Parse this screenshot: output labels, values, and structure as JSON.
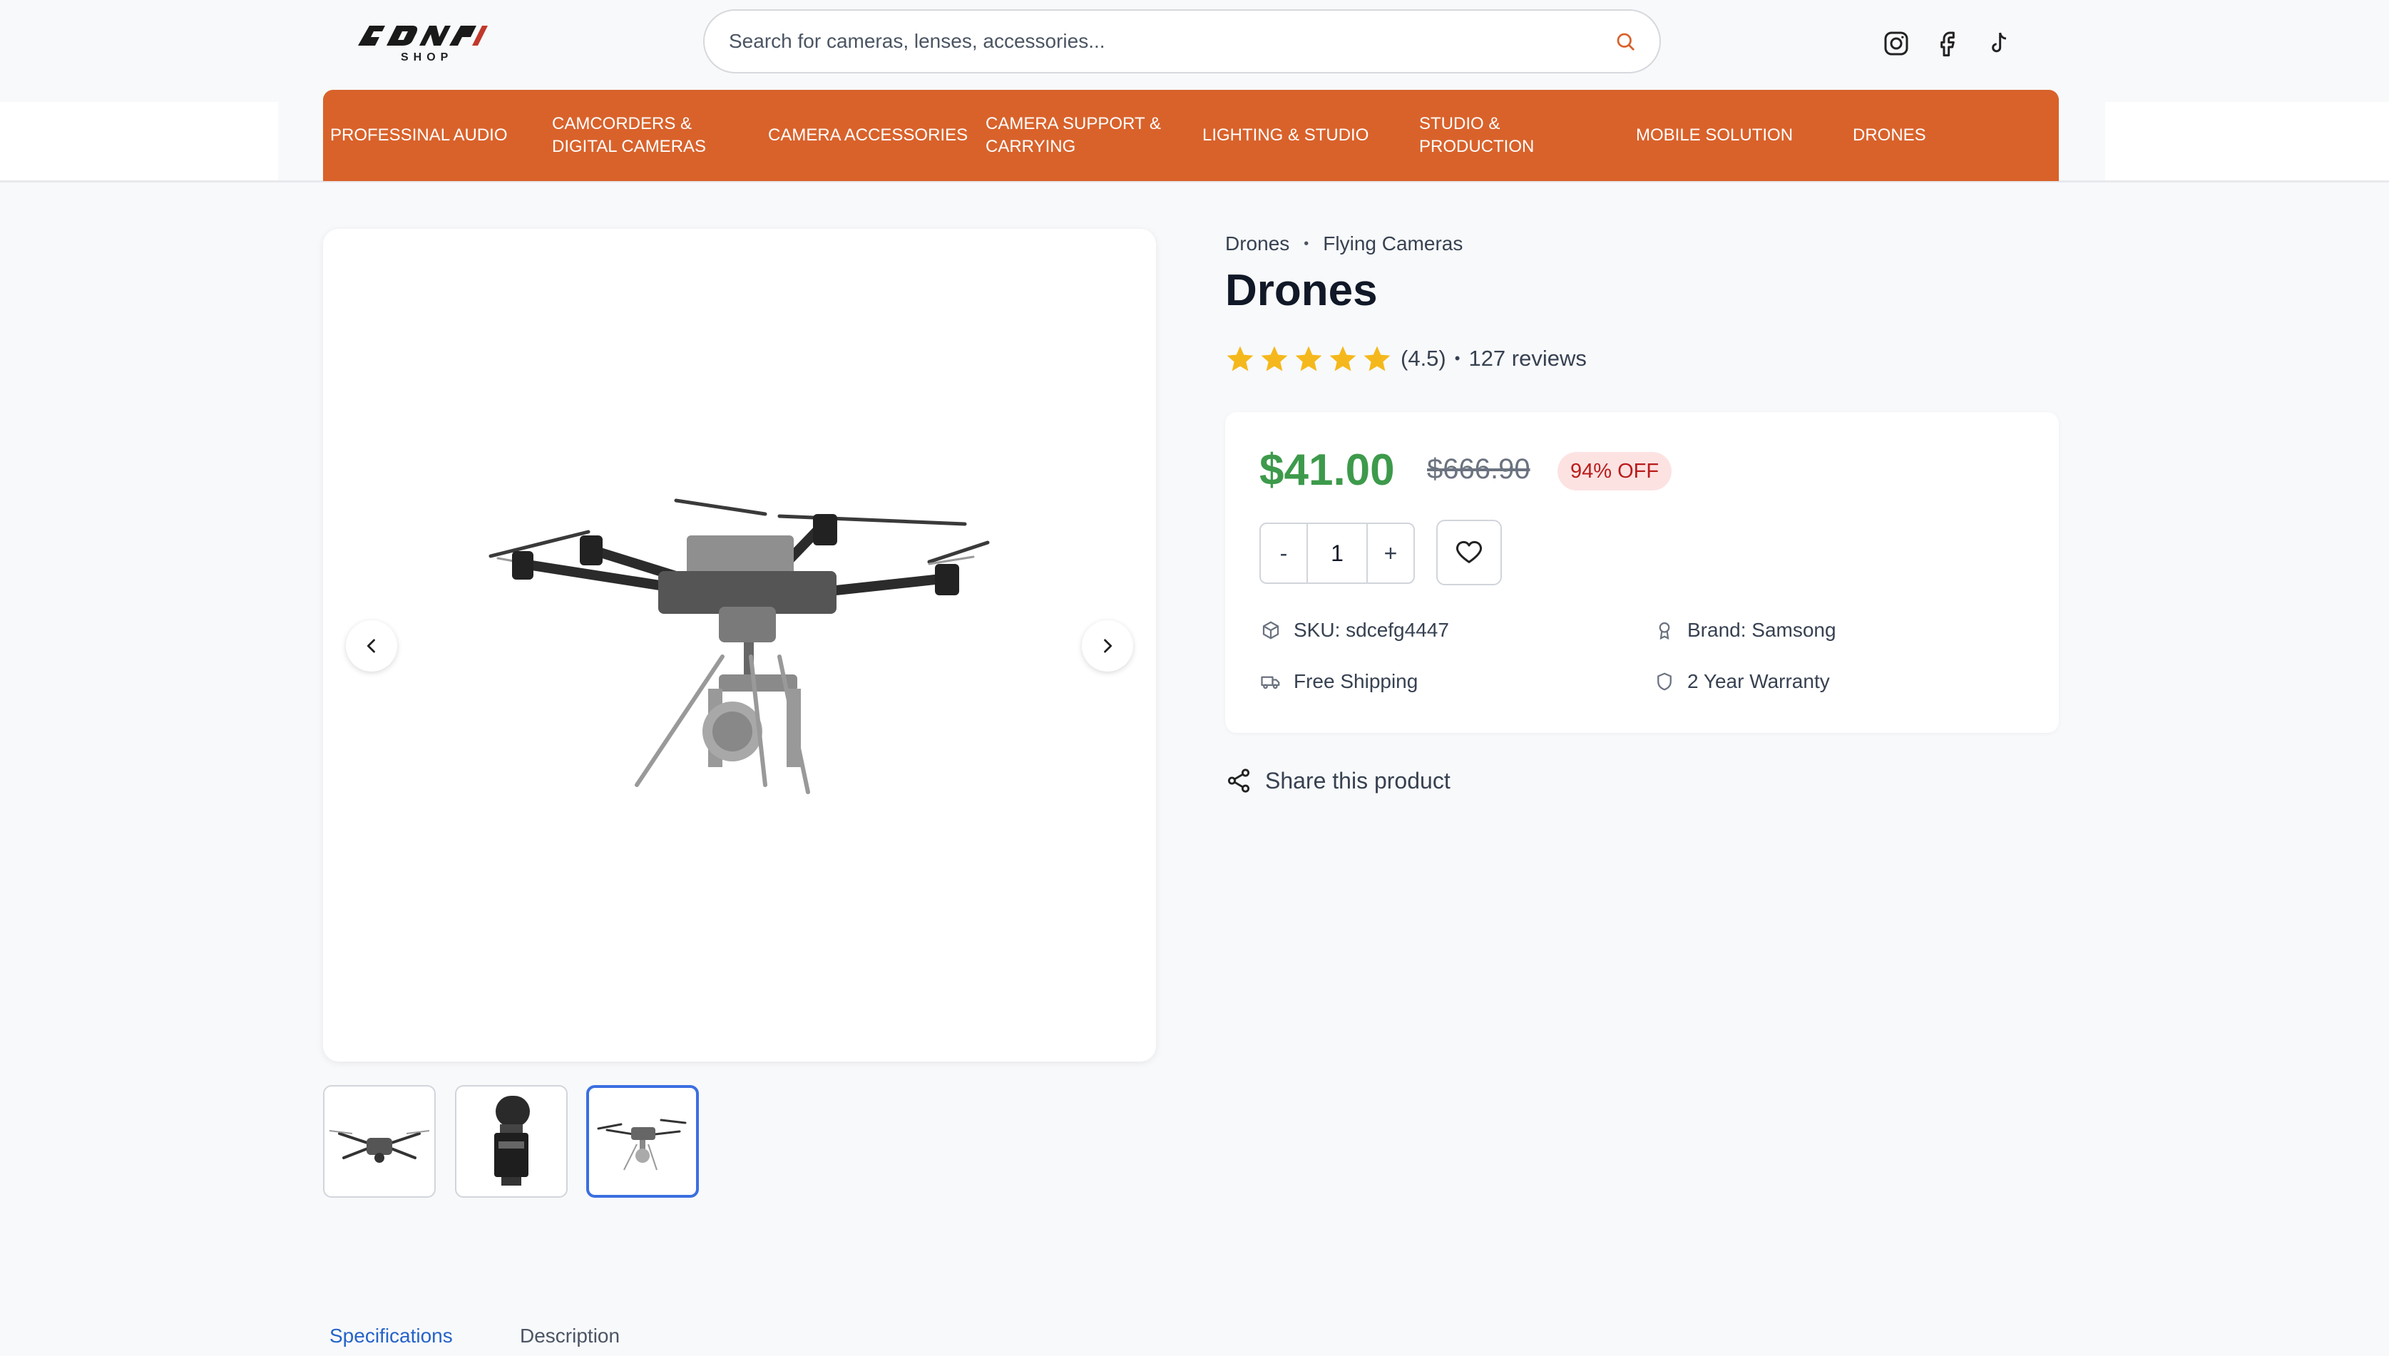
{
  "header": {
    "logo_text": "ADNAN",
    "logo_sub": "SHOP",
    "search_placeholder": "Search for cameras, lenses, accessories...",
    "social_icons": [
      "instagram-icon",
      "facebook-icon",
      "tiktok-icon"
    ]
  },
  "nav": {
    "items": [
      {
        "label": "PROFESSINAL AUDIO"
      },
      {
        "label": "CAMCORDERS & DIGITAL CAMERAS"
      },
      {
        "label": "CAMERA ACCESSORIES"
      },
      {
        "label": "CAMERA SUPPORT & CARRYING"
      },
      {
        "label": "LIGHTING & STUDIO"
      },
      {
        "label": "STUDIO & PRODUCTION"
      },
      {
        "label": "MOBILE SOLUTION"
      },
      {
        "label": "DRONES"
      }
    ],
    "color": "#d9622b"
  },
  "gallery": {
    "thumbnails": [
      {
        "subject": "folding drone"
      },
      {
        "subject": "camera flash"
      },
      {
        "subject": "hexacopter drone"
      }
    ],
    "active_thumbnail": 3
  },
  "product": {
    "breadcrumb": [
      "Drones",
      "Flying Cameras"
    ],
    "title": "Drones",
    "rating": 4.5,
    "rating_text": "(4.5)",
    "rating_sep": "•",
    "reviews_text": "127 reviews",
    "price": "$41.00",
    "old_price": "$666.90",
    "discount": "94% OFF",
    "quantity": "1",
    "qty_minus": "-",
    "qty_plus": "+",
    "sku": "SKU: sdcefg4447",
    "brand": "Brand: Samsong",
    "shipping": "Free Shipping",
    "warranty": "2 Year Warranty",
    "share": "Share this product",
    "price_color": "#3d9a4b"
  },
  "tabs": [
    {
      "label": "Specifications",
      "active": true
    },
    {
      "label": "Description",
      "active": false
    }
  ]
}
